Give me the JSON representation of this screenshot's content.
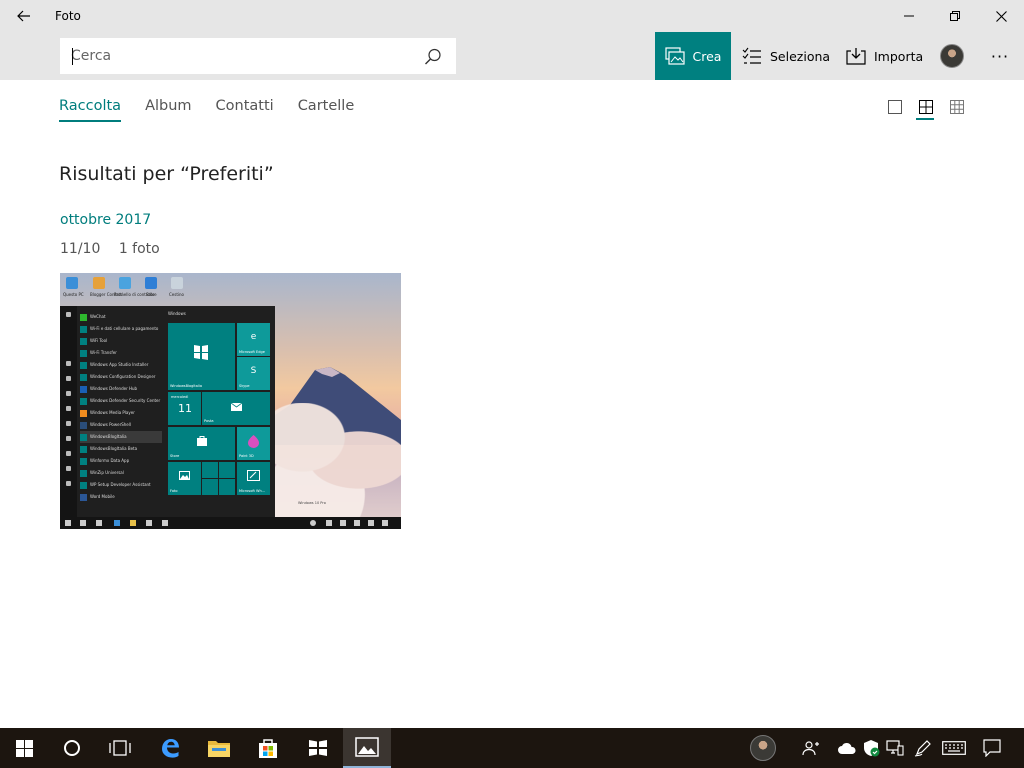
{
  "window": {
    "title": "Foto"
  },
  "commandbar": {
    "search_placeholder": "Cerca",
    "create_label": "Crea",
    "select_label": "Seleziona",
    "import_label": "Importa",
    "more_label": "···"
  },
  "nav": {
    "tabs": [
      {
        "label": "Raccolta",
        "active": true
      },
      {
        "label": "Album",
        "active": false
      },
      {
        "label": "Contatti",
        "active": false
      },
      {
        "label": "Cartelle",
        "active": false
      }
    ],
    "view_mode_selected": "medium"
  },
  "content": {
    "results_title": "Risultati per “Preferiti”",
    "group_month": "ottobre 2017",
    "group_date": "11/10",
    "group_count": "1 foto"
  },
  "thumbnail": {
    "desktop_icons": [
      "Questo PC",
      "Blogger Contatti",
      "Pannello di controllo",
      "Store",
      "Cestino"
    ],
    "apps": [
      "WeChat",
      "Wi-Fi e dati cellulare a pagamento",
      "WiFi Tool",
      "Wi-Fi Transfer",
      "Windows App Studio Installer",
      "Windows Configuration Designer",
      "Windows Defender Hub",
      "Windows Defender Security Center",
      "Windows Media Player",
      "Windows PowerShell",
      "WindowsBlogItalia",
      "WindowsBlogItalia Beta",
      "Winformx Data App",
      "WinZip Universal",
      "WP Setup Developer Assistant",
      "Word Mobile"
    ],
    "highlighted_app": "WindowsBlogItalia",
    "tiles_header": "Windows",
    "tiles": {
      "blog": "WindowsBlogItalia",
      "edge": "Microsoft Edge",
      "skype": "Skype",
      "calendar_day": "11",
      "calendar_top": "mercoledì",
      "mail": "Posta",
      "store": "Store",
      "paint": "Paint 3D",
      "photos": "Foto",
      "whiteboard": "Microsoft Wh..."
    },
    "watermark": "Windows 10 Pro"
  },
  "taskbar": {
    "items": [
      "start",
      "cortana",
      "task-view",
      "edge",
      "file-explorer",
      "store",
      "windowsblogitalia",
      "photos"
    ],
    "active": "photos"
  },
  "colors": {
    "accent": "#008080",
    "titlebar": "#e6e6e6",
    "taskbar": "#1c150f",
    "link": "#007d7d"
  }
}
